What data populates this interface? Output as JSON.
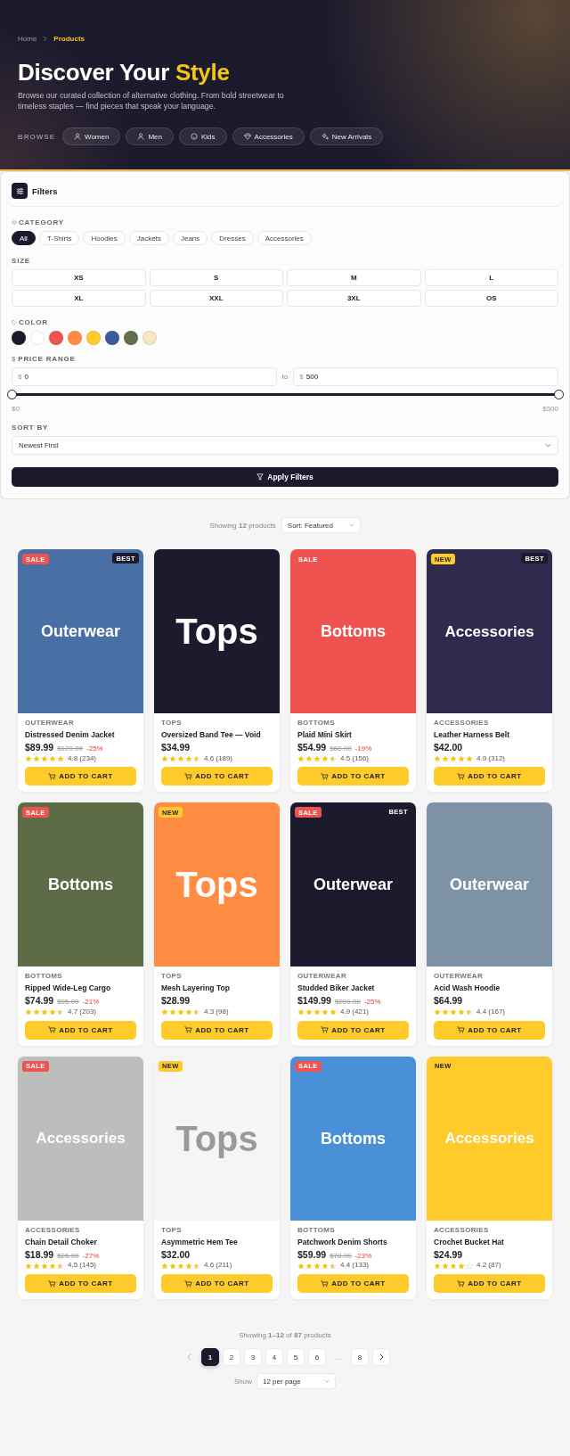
{
  "breadcrumb": [
    {
      "label": "Home",
      "selected": false
    },
    {
      "label": "Products",
      "selected": true
    }
  ],
  "hero": {
    "title": "Discover Your",
    "title_accent": "Style",
    "description": "Browse our curated collection of alternative clothing. From bold streetwear to timeless staples — find pieces that speak your language.",
    "browse_label": "BROWSE",
    "chips": [
      "Women",
      "Men",
      "Kids",
      "Accessories",
      "New Arrivals"
    ]
  },
  "filters": {
    "title": "Filters",
    "category": {
      "label": "CATEGORY",
      "options": [
        {
          "label": "All",
          "selected": true
        },
        {
          "label": "T-Shirts",
          "selected": false
        },
        {
          "label": "Hoodies",
          "selected": false
        },
        {
          "label": "Jackets",
          "selected": false
        },
        {
          "label": "Jeans",
          "selected": false
        },
        {
          "label": "Dresses",
          "selected": false
        },
        {
          "label": "Accessories",
          "selected": false
        }
      ]
    },
    "size": {
      "label": "SIZE",
      "options": [
        {
          "label": "XS",
          "selected": false
        },
        {
          "label": "S",
          "selected": false
        },
        {
          "label": "M",
          "selected": false
        },
        {
          "label": "L",
          "selected": false
        },
        {
          "label": "XL",
          "selected": false
        },
        {
          "label": "XXL",
          "selected": false
        },
        {
          "label": "3XL",
          "selected": false
        },
        {
          "label": "OS",
          "selected": false
        }
      ]
    },
    "color": {
      "label": "COLOR",
      "swatches": [
        {
          "color": "#1c1b2e",
          "selected": false
        },
        {
          "color": "#ffffff",
          "selected": false
        },
        {
          "color": "#ef5350",
          "selected": false
        },
        {
          "color": "#ff8c42",
          "selected": false
        },
        {
          "color": "#ffcb2b",
          "selected": false
        },
        {
          "color": "#3d5a9a",
          "selected": false
        },
        {
          "color": "#636e4e",
          "selected": false
        },
        {
          "color": "#f5e6c8",
          "selected": false
        }
      ]
    },
    "price": {
      "icon": "$",
      "label": "PRICE RANGE",
      "currency": "$",
      "min": "0",
      "to": "to",
      "max": "500",
      "slider": {
        "level": 1
      },
      "min_label": "$0",
      "max_label": "$500"
    },
    "sort": {
      "label": "SORT BY",
      "value": "Newest First"
    },
    "apply": "Apply Filters"
  },
  "toolbar": {
    "showing": "Showing **12** products",
    "sort": "Sort: Featured"
  },
  "products": [
    {
      "category": "OUTERWEAR",
      "name": "Distressed Denim Jacket",
      "price": "$89.99",
      "old_price": "$120.00",
      "discount": "-25%",
      "stars": 5,
      "rating": "4.8 (234)",
      "image": {
        "label": "Outerwear",
        "color": "#4a6fa5"
      },
      "badges": [
        {
          "kind": "sale",
          "text": "SALE"
        },
        {
          "kind": "best",
          "text": "BEST"
        }
      ],
      "button": "ADD TO CART"
    },
    {
      "category": "TOPS",
      "name": "Oversized Band Tee — Void",
      "price": "$34.99",
      "stars": 4.5,
      "rating": "4.6 (189)",
      "image": {
        "label": "Tops",
        "color": "#1c1b2e"
      },
      "button": "ADD TO CART"
    },
    {
      "category": "BOTTOMS",
      "name": "Plaid Mini Skirt",
      "price": "$54.99",
      "old_price": "$68.00",
      "discount": "-19%",
      "stars": 4.5,
      "rating": "4.5 (156)",
      "image": {
        "label": "Bottoms",
        "color": "#ef5350"
      },
      "badges": [
        {
          "kind": "sale",
          "text": "SALE"
        }
      ],
      "button": "ADD TO CART"
    },
    {
      "category": "ACCESSORIES",
      "name": "Leather Harness Belt",
      "price": "$42.00",
      "stars": 5,
      "rating": "4.9 (312)",
      "image": {
        "label": "Accessories",
        "color": "#2e2b4e"
      },
      "badges": [
        {
          "kind": "new",
          "text": "NEW"
        },
        {
          "kind": "best",
          "text": "BEST"
        }
      ],
      "button": "ADD TO CART"
    },
    {
      "category": "BOTTOMS",
      "name": "Ripped Wide-Leg Cargo",
      "price": "$74.99",
      "old_price": "$95.00",
      "discount": "-21%",
      "stars": 4.5,
      "rating": "4.7 (203)",
      "image": {
        "label": "Bottoms",
        "color": "#5d6b47"
      },
      "badges": [
        {
          "kind": "sale",
          "text": "SALE"
        }
      ],
      "button": "ADD TO CART"
    },
    {
      "category": "TOPS",
      "name": "Mesh Layering Top",
      "price": "$28.99",
      "stars": 4.5,
      "rating": "4.3 (98)",
      "image": {
        "label": "Tops",
        "color": "#ff8c42"
      },
      "badges": [
        {
          "kind": "new",
          "text": "NEW"
        }
      ],
      "button": "ADD TO CART"
    },
    {
      "category": "OUTERWEAR",
      "name": "Studded Biker Jacket",
      "price": "$149.99",
      "old_price": "$200.00",
      "discount": "-25%",
      "stars": 5,
      "rating": "4.9 (421)",
      "image": {
        "label": "Outerwear",
        "color": "#1c1b2e"
      },
      "badges": [
        {
          "kind": "sale",
          "text": "SALE"
        },
        {
          "kind": "best",
          "text": "BEST"
        }
      ],
      "button": "ADD TO CART"
    },
    {
      "category": "OUTERWEAR",
      "name": "Acid Wash Hoodie",
      "price": "$64.99",
      "stars": 4.5,
      "rating": "4.4 (167)",
      "image": {
        "label": "Outerwear",
        "color": "#7f93a6"
      },
      "button": "ADD TO CART"
    },
    {
      "category": "ACCESSORIES",
      "name": "Chain Detail Choker",
      "price": "$18.99",
      "old_price": "$26.00",
      "discount": "-27%",
      "stars": 4.5,
      "rating": "4.5 (145)",
      "image": {
        "label": "Accessories",
        "color": "#bdbdbd"
      },
      "badges": [
        {
          "kind": "sale",
          "text": "SALE"
        }
      ],
      "button": "ADD TO CART"
    },
    {
      "category": "TOPS",
      "name": "Asymmetric Hem Tee",
      "price": "$32.00",
      "stars": 4.5,
      "rating": "4.6 (211)",
      "image": {
        "label": "Tops",
        "color": "#f5f5f5"
      },
      "badges": [
        {
          "kind": "new",
          "text": "NEW"
        }
      ],
      "button": "ADD TO CART"
    },
    {
      "category": "BOTTOMS",
      "name": "Patchwork Denim Shorts",
      "price": "$59.99",
      "old_price": "$78.00",
      "discount": "-23%",
      "stars": 4.5,
      "rating": "4.4 (133)",
      "image": {
        "label": "Bottoms",
        "color": "#4a90d9"
      },
      "badges": [
        {
          "kind": "sale",
          "text": "SALE"
        }
      ],
      "button": "ADD TO CART"
    },
    {
      "category": "ACCESSORIES",
      "name": "Crochet Bucket Hat",
      "price": "$24.99",
      "stars": 4,
      "rating": "4.2 (87)",
      "image": {
        "label": "Accessories",
        "color": "#ffcb2b"
      },
      "badges": [
        {
          "kind": "new",
          "text": "NEW"
        }
      ],
      "button": "ADD TO CART"
    }
  ],
  "pagination": {
    "summary": "Showing **1–12** of **87** products",
    "pages": [
      {
        "label": "1",
        "selected": true
      },
      {
        "label": "2",
        "selected": false
      },
      {
        "label": "3",
        "selected": false
      },
      {
        "label": "4",
        "selected": false
      },
      {
        "label": "5",
        "selected": false
      },
      {
        "label": "6",
        "selected": false
      },
      {
        "label": "…",
        "kind": "gap",
        "selected": false
      },
      {
        "label": "8",
        "selected": false
      }
    ],
    "show_label": "Show",
    "per_page": "12 per page"
  }
}
